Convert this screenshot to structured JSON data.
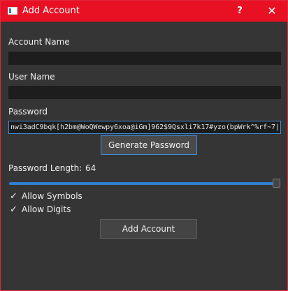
{
  "window": {
    "title": "Add Account",
    "help_glyph": "?",
    "close_glyph": "✕"
  },
  "form": {
    "account_name_label": "Account Name",
    "account_name_value": "",
    "user_name_label": "User Name",
    "user_name_value": "",
    "password_label": "Password",
    "password_value": "nwi3adC9bqk[h2bm@WoQWewpy6xoa@iGm]962$9Qsxli7k17#yzo(bpWrk^%rf~7|",
    "generate_button": "Generate Password",
    "length_label": "Password Length:",
    "length_value": "64",
    "length_slider": {
      "value": 64,
      "max": 64
    },
    "allow_symbols_label": "Allow Symbols",
    "allow_symbols_checked": true,
    "allow_digits_label": "Allow Digits",
    "allow_digits_checked": true,
    "check_glyph": "✓",
    "add_button": "Add Account"
  },
  "colors": {
    "title_bar": "#e81123",
    "accent": "#3d8ee0",
    "background": "#353535"
  },
  "icons": {
    "app": "window-icon",
    "help": "help-icon",
    "close": "close-icon"
  }
}
